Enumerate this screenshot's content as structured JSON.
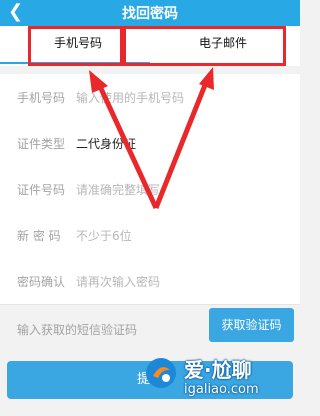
{
  "header": {
    "title": "找回密码",
    "back_icon": "back-chevron-icon"
  },
  "tabs": [
    {
      "label": "手机号码",
      "active": true
    },
    {
      "label": "电子邮件",
      "active": false
    }
  ],
  "form": {
    "phone": {
      "label": "手机号码",
      "placeholder": "输入使用的手机号码"
    },
    "id_type": {
      "label": "证件类型",
      "value": "二代身份证"
    },
    "id_number": {
      "label": "证件号码",
      "placeholder": "请准确完整填写"
    },
    "new_password": {
      "label": "新 密 码",
      "placeholder": "不少于6位"
    },
    "confirm_password": {
      "label": "密码确认",
      "placeholder": "请再次输入密码"
    },
    "sms": {
      "placeholder": "输入获取的短信验证码",
      "button_label": "获取验证码"
    }
  },
  "submit": {
    "label": "提交"
  },
  "watermark": {
    "brand": "爱·尬聊",
    "domain": "igaliao.com"
  },
  "colors": {
    "accent": "#29a8e6",
    "highlight": "#e8282b"
  }
}
